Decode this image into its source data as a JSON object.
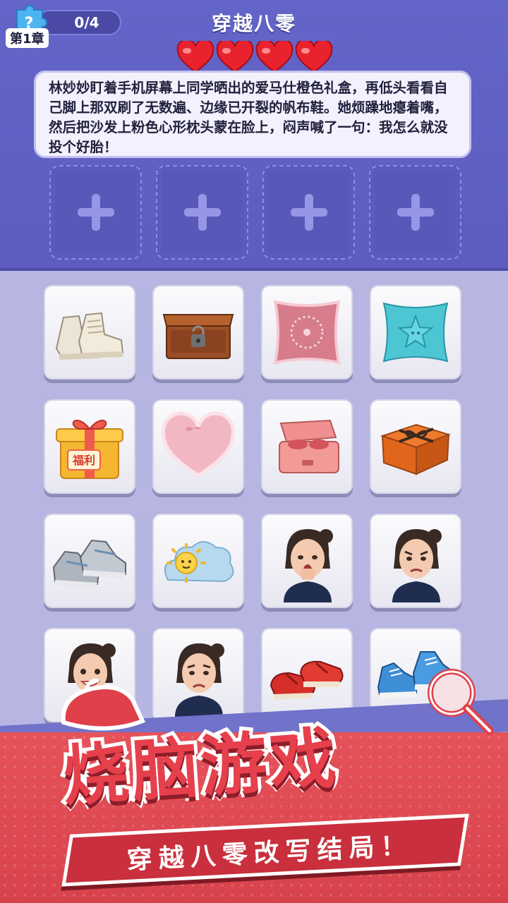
{
  "header": {
    "progress": "0/4",
    "chapter": "第1章",
    "title": "穿越八零",
    "lives": 4,
    "hearts": [
      "heart",
      "heart",
      "heart",
      "heart"
    ]
  },
  "story": {
    "text": "林妙妙盯着手机屏幕上同学晒出的爱马仕橙色礼盒，再低头看看自己脚上那双刷了无数遍、边缘已开裂的帆布鞋。她烦躁地瘪着嘴，然后把沙发上粉色心形枕头蒙在脸上，闷声喊了一句：我怎么就没投个好胎！"
  },
  "slots": [
    {
      "icon": "plus-icon"
    },
    {
      "icon": "plus-icon"
    },
    {
      "icon": "plus-icon"
    },
    {
      "icon": "plus-icon"
    }
  ],
  "items": [
    {
      "name": "canvas-sneakers"
    },
    {
      "name": "wooden-lock-box"
    },
    {
      "name": "pink-embroidered-pillow"
    },
    {
      "name": "blue-star-pillow"
    },
    {
      "name": "yellow-gift-box",
      "label": "福利"
    },
    {
      "name": "pink-heart-pillow"
    },
    {
      "name": "pink-lunch-box"
    },
    {
      "name": "orange-gift-box"
    },
    {
      "name": "grey-running-shoes"
    },
    {
      "name": "sun-cloud-pillow"
    },
    {
      "name": "girl-yawning"
    },
    {
      "name": "girl-frowning"
    },
    {
      "name": "girl-smiling"
    },
    {
      "name": "girl-sad"
    },
    {
      "name": "red-flat-shoes"
    },
    {
      "name": "blue-sneakers"
    }
  ],
  "promo": {
    "headline": "烧脑游戏",
    "tagline": "穿越八零改写结局！"
  },
  "colors": {
    "panel": "#5c5dbf",
    "background": "#b7b6e2",
    "heart": "#e8232e",
    "banner": "#d8424c"
  }
}
